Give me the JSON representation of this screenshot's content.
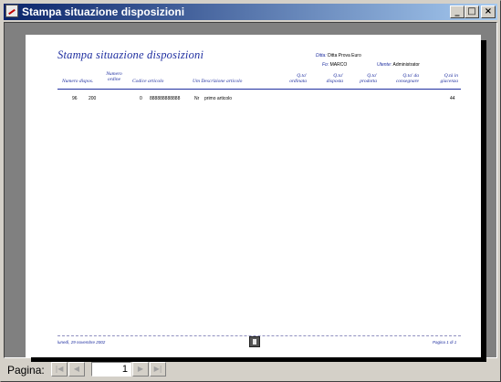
{
  "window": {
    "title": "Stampa situazione disposizioni",
    "minimize_glyph": "_",
    "maximize_glyph": "□",
    "close_glyph": "×"
  },
  "report": {
    "title": "Stampa situazione disposizioni",
    "meta": {
      "ditta_label": "Ditta:",
      "ditta_value": "Ditta Prova Euro",
      "fo_label": "Fo:",
      "fo_value": "MARCO",
      "utente_label": "Utente:",
      "utente_value": "Administrator"
    },
    "columns": {
      "numero_dispos": "Numero dispos.",
      "numero_ordine": "Numero ordine",
      "codice_articolo": "Codice articolo",
      "um_descrizione": "Um Descrizione articolo",
      "qta_ordinata": "Q.ta' ordinata",
      "qta_disposta": "Q.ta' disposta",
      "qta_prodotta": "Q.ta' prodotta",
      "qta_consegnare": "Q.ta' da consegnare",
      "qta_giacenza": "Q.tà in giacenza"
    },
    "rows": [
      {
        "numero_dispos": "96",
        "numero_ordine_a": "200",
        "numero_ordine_b": "0",
        "codice_articolo": "888888888888",
        "um": "Nr",
        "descrizione": "primo articolo",
        "qta_giacenza": "44"
      }
    ],
    "footer": {
      "date": "lunedì, 29 novembre 2002",
      "page": "Pagina 1 di 1"
    }
  },
  "statusbar": {
    "pagina_label": "Pagina:",
    "first_glyph": "|◀",
    "prev_glyph": "◀",
    "current_page": "1",
    "next_glyph": "▶",
    "last_glyph": "▶|"
  }
}
